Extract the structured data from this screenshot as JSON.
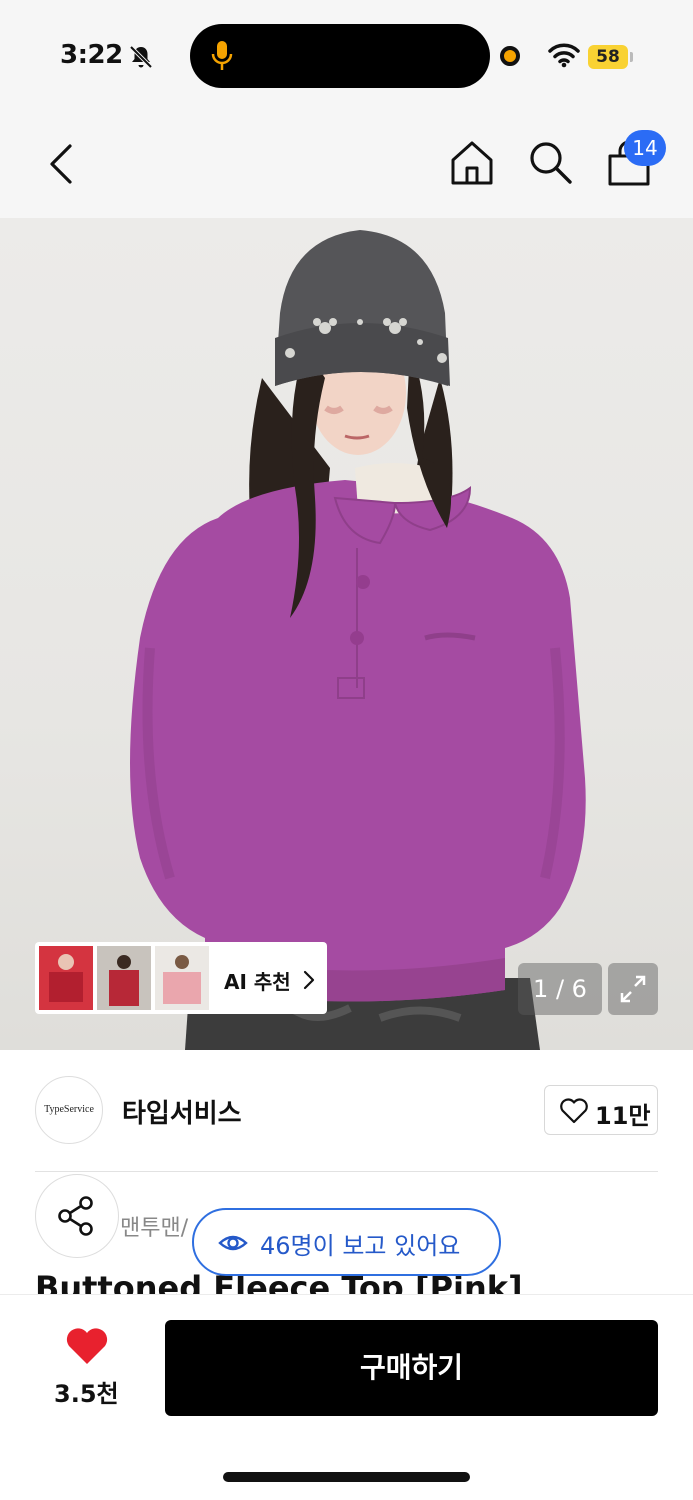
{
  "status_bar": {
    "time": "3:22",
    "battery": "58"
  },
  "nav": {
    "cart_badge": "14"
  },
  "gallery": {
    "ai_label": "AI 추천",
    "counter": "1 / 6"
  },
  "brand": {
    "logo_text": "TypeService",
    "name": "타입서비스",
    "likes": "11만"
  },
  "product": {
    "category": "맨투맨/",
    "viewers": "46명이 보고 있어요",
    "title": "Buttoned Fleece Top [Pink]"
  },
  "bottom": {
    "fav_count": "3.5천",
    "buy_label": "구매하기"
  },
  "colors": {
    "accent_blue": "#2b6cf5",
    "heart_red": "#e8212e",
    "buy_black": "#000000"
  },
  "icons": [
    "back-icon",
    "home-icon",
    "search-icon",
    "shopping-bag-icon",
    "share-icon",
    "eye-icon",
    "heart-icon",
    "expand-icon",
    "chevron-right-icon",
    "bell-off-icon",
    "mic-icon",
    "wifi-icon"
  ]
}
